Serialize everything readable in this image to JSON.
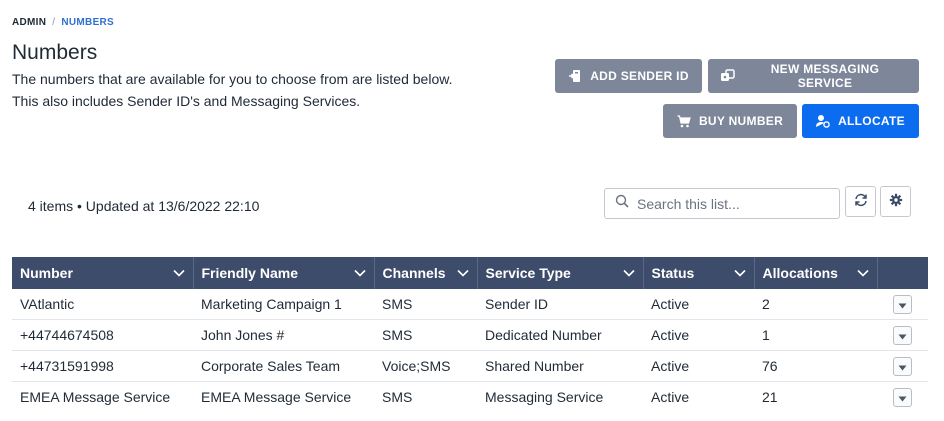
{
  "breadcrumb": {
    "root": "ADMIN",
    "separator": "/",
    "current": "NUMBERS"
  },
  "page": {
    "title": "Numbers",
    "description_line1": "The numbers that are available for you to choose from are listed below.",
    "description_line2": "This also includes Sender ID's and Messaging Services."
  },
  "actions": {
    "add_sender_id": "ADD SENDER ID",
    "new_messaging_service": "NEW MESSAGING SERVICE",
    "buy_number": "BUY NUMBER",
    "allocate": "ALLOCATE"
  },
  "list_meta": "4 items • Updated at 13/6/2022 22:10",
  "search": {
    "placeholder": "Search this list..."
  },
  "icons": {
    "add_sender": "sender-id-icon",
    "new_service": "messaging-service-icon",
    "buy": "cart-icon",
    "allocate": "user-allocate-icon",
    "search": "search-icon",
    "refresh": "refresh-icon",
    "settings": "gear-icon",
    "column_menu": "chevron-down-icon",
    "row_menu": "caret-down-icon"
  },
  "colors": {
    "header_bg": "#3d4c6b",
    "primary": "#0b6cf0",
    "secondary": "#7d8799",
    "link": "#2f6fd1"
  },
  "table": {
    "columns": [
      "Number",
      "Friendly Name",
      "Channels",
      "Service Type",
      "Status",
      "Allocations"
    ],
    "rows": [
      [
        "VAtlantic",
        "Marketing Campaign 1",
        "SMS",
        "Sender ID",
        "Active",
        "2"
      ],
      [
        "+44744674508",
        "John Jones #",
        "SMS",
        "Dedicated Number",
        "Active",
        "1"
      ],
      [
        "+44731591998",
        "Corporate Sales Team",
        "Voice;SMS",
        "Shared Number",
        "Active",
        "76"
      ],
      [
        "EMEA Message Service",
        "EMEA Message Service",
        "SMS",
        "Messaging Service",
        "Active",
        "21"
      ]
    ]
  }
}
